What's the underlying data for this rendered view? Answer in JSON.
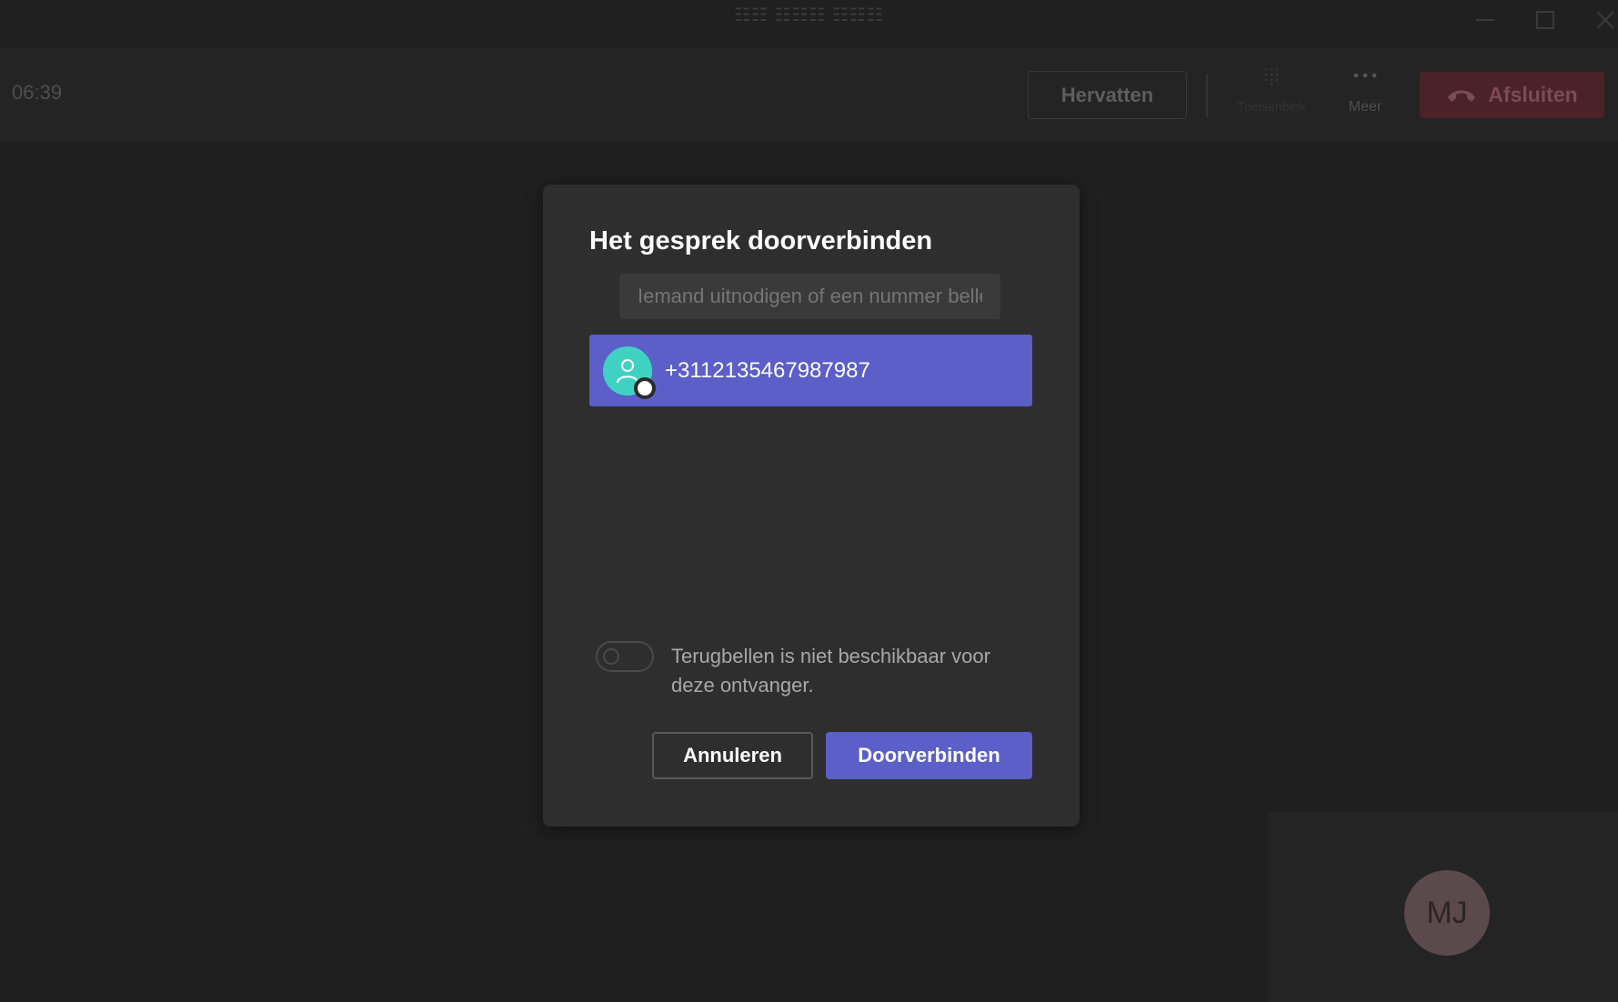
{
  "window": {
    "title": "☷☷ ☷☷☷ ☷☷☷",
    "controls": [
      "minimize-icon",
      "maximize-icon",
      "close-icon"
    ]
  },
  "callbar": {
    "timer": "06:39",
    "resume_label": "Hervatten",
    "keypad_label": "Toetsenblok",
    "more_label": "Meer",
    "hangup_label": "Afsluiten"
  },
  "dialog": {
    "title": "Het gesprek doorverbinden",
    "search_placeholder": "Iemand uitnodigen of een nummer bellen",
    "suggestion": {
      "number": "+3112135467987987",
      "icon": "person-icon"
    },
    "callback_toggle": {
      "label": "Terugbellen is niet beschikbaar voor deze ontvanger.",
      "enabled": false
    },
    "cancel_label": "Annuleren",
    "transfer_label": "Doorverbinden"
  },
  "self_view": {
    "initials": "MJ"
  },
  "colors": {
    "accent": "#5b5fc7",
    "hangup": "#c4314b",
    "avatar_teal": "#3fd2c3",
    "background": "#1f1f1f",
    "dialog_bg": "#2e2e2e"
  }
}
